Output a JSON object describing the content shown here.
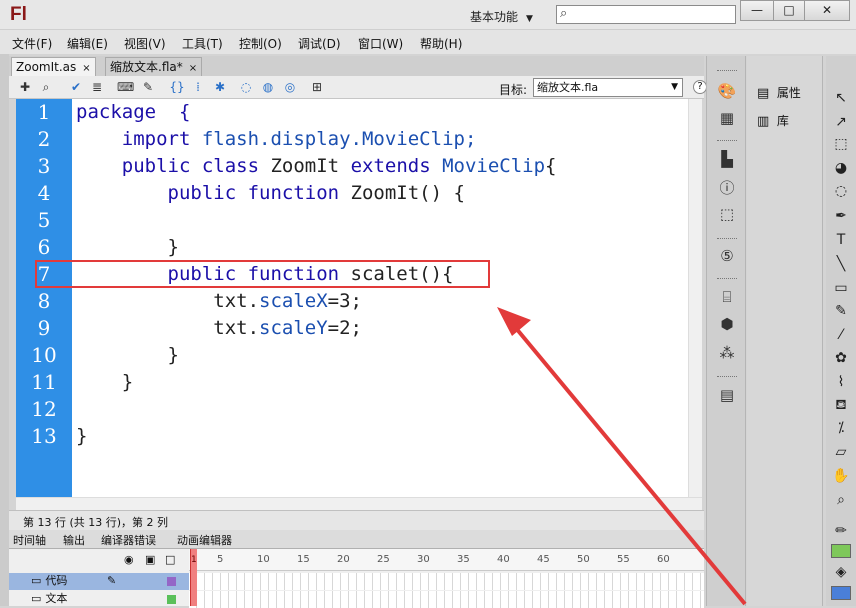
{
  "app": {
    "logo": "Fl",
    "workspace": "基本功能",
    "window_buttons": {
      "minimize": "—",
      "maximize": "□",
      "close": "✕"
    }
  },
  "menu": [
    "文件(F)",
    "编辑(E)",
    "视图(V)",
    "工具(T)",
    "控制(O)",
    "调试(D)",
    "窗口(W)",
    "帮助(H)"
  ],
  "tabs": [
    {
      "label": "ZoomIt.as",
      "close": "×"
    },
    {
      "label": "缩放文本.fla*",
      "close": "×"
    }
  ],
  "toolbar": {
    "target_label": "目标:",
    "target_value": "缩放文本.fla",
    "help": "?",
    "icons": [
      "add-statement-icon",
      "find-icon",
      "check-syntax-icon",
      "auto-format-icon",
      "code-hint-icon",
      "debug-options-icon",
      "collapse-braces-icon",
      "collapse-selection-icon",
      "expand-all-icon",
      "apply-block-comment-icon",
      "apply-line-comment-icon",
      "remove-comment-icon",
      "show-hide-toolbox-icon",
      "code-snippets-icon"
    ]
  },
  "code": {
    "line_numbers": [
      "1",
      "2",
      "3",
      "4",
      "5",
      "6",
      "7",
      "8",
      "9",
      "10",
      "11",
      "12",
      "13"
    ],
    "lines": [
      [
        {
          "t": "package  {",
          "c": "kw"
        }
      ],
      [
        {
          "t": "    "
        },
        {
          "t": "import",
          "c": "kw"
        },
        {
          "t": " flash.display.MovieClip;",
          "c": "cl"
        }
      ],
      [
        {
          "t": "    "
        },
        {
          "t": "public class",
          "c": "kw"
        },
        {
          "t": " ZoomIt "
        },
        {
          "t": "extends",
          "c": "kw"
        },
        {
          "t": " MovieClip",
          "c": "cl"
        },
        {
          "t": "{"
        }
      ],
      [
        {
          "t": "        "
        },
        {
          "t": "public function",
          "c": "kw"
        },
        {
          "t": " ZoomIt() {"
        }
      ],
      [
        {
          "t": ""
        }
      ],
      [
        {
          "t": "        }"
        }
      ],
      [
        {
          "t": "        "
        },
        {
          "t": "public function",
          "c": "kw"
        },
        {
          "t": " scalet(){"
        }
      ],
      [
        {
          "t": "            txt."
        },
        {
          "t": "scaleX",
          "c": "cl"
        },
        {
          "t": "=3;"
        }
      ],
      [
        {
          "t": "            txt."
        },
        {
          "t": "scaleY",
          "c": "cl"
        },
        {
          "t": "=2;"
        }
      ],
      [
        {
          "t": "        }"
        }
      ],
      [
        {
          "t": "    }"
        }
      ],
      [
        {
          "t": ""
        }
      ],
      [
        {
          "t": "}"
        }
      ]
    ]
  },
  "status": "第 13 行 (共 13 行)，第 2 列",
  "bottom_tabs": [
    "时间轴",
    "输出",
    "编译器错误",
    "动画编辑器"
  ],
  "timeline": {
    "ruler": [
      "5",
      "10",
      "15",
      "20",
      "25",
      "30",
      "35",
      "40",
      "45",
      "50",
      "55",
      "60"
    ],
    "frame_marker": "1",
    "layers": [
      {
        "name": "代码",
        "selected": true
      },
      {
        "name": "文本",
        "selected": false
      }
    ]
  },
  "panels": [
    {
      "label": "属性",
      "icon": "properties-icon"
    },
    {
      "label": "库",
      "icon": "library-icon"
    }
  ],
  "colors": {
    "gutter": "#2f8fe6",
    "keyword": "#1b0fa8",
    "class": "#1b4fb0",
    "highlight_box": "#e23a3a",
    "annotation_arrow": "#e23a3a"
  }
}
